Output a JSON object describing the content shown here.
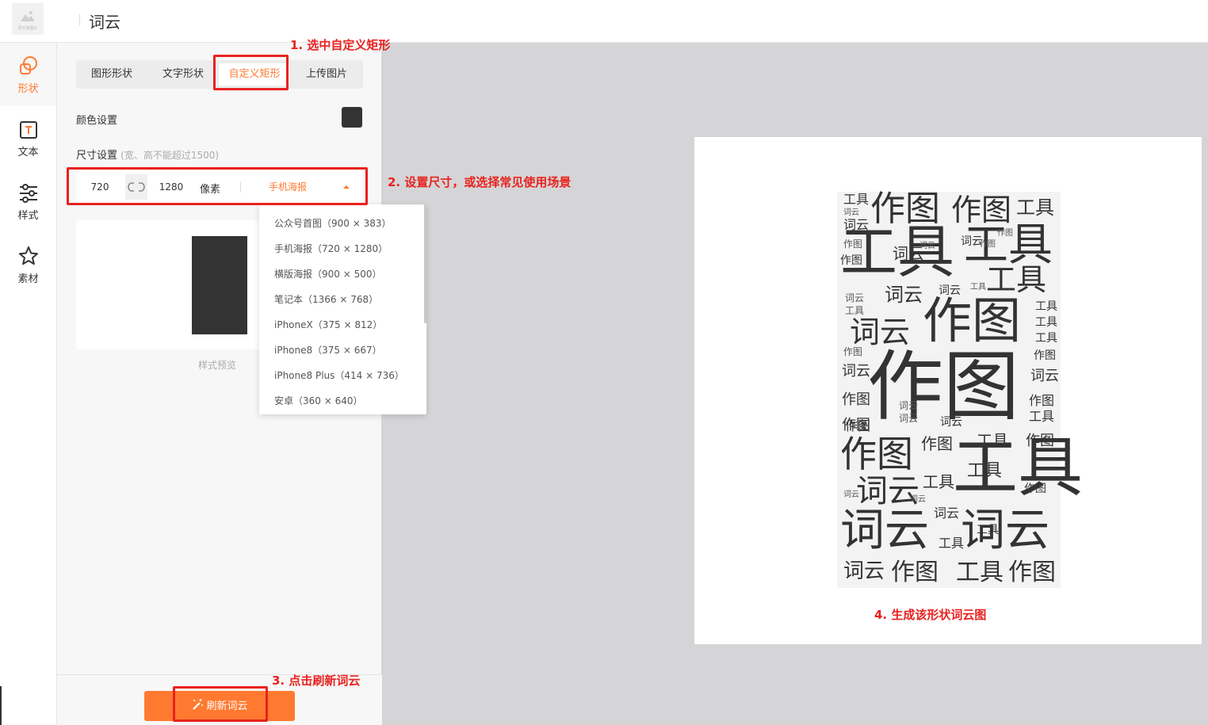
{
  "app": {
    "logo_caption": "再不用图片",
    "title": "词云"
  },
  "nav": [
    {
      "label": "形状",
      "icon": "shape-icon",
      "active": true
    },
    {
      "label": "文本",
      "icon": "text-icon"
    },
    {
      "label": "样式",
      "icon": "sliders-icon"
    },
    {
      "label": "素材",
      "icon": "star-icon"
    }
  ],
  "tabs": [
    "图形形状",
    "文字形状",
    "自定义矩形",
    "上传图片"
  ],
  "active_tab": "自定义矩形",
  "color_setting": {
    "label": "颜色设置",
    "color": "#333333"
  },
  "size_setting": {
    "label": "尺寸设置",
    "hint": "(宽、高不能超过1500)",
    "width": "720",
    "height": "1280",
    "unit": "像素",
    "preset": "手机海报"
  },
  "presets": [
    "公众号首图（900 × 383）",
    "手机海报（720 × 1280）",
    "横版海报（900 × 500）",
    "笔记本（1366 × 768）",
    "iPhoneX（375 × 812）",
    "iPhone8（375 × 667）",
    "iPhone8 Plus（414 × 736）",
    "安卓（360 × 640）"
  ],
  "preview_label": "样式预览",
  "refresh_label": "刷新词云",
  "accent": "#ff7a30",
  "annotations": [
    "1. 选中自定义矩形",
    "2. 设置尺寸，或选择常见使用场景",
    "3. 点击刷新词云",
    "4. 生成该形状词云图"
  ],
  "wordcloud_words": [
    "作图",
    "工具",
    "词云"
  ]
}
